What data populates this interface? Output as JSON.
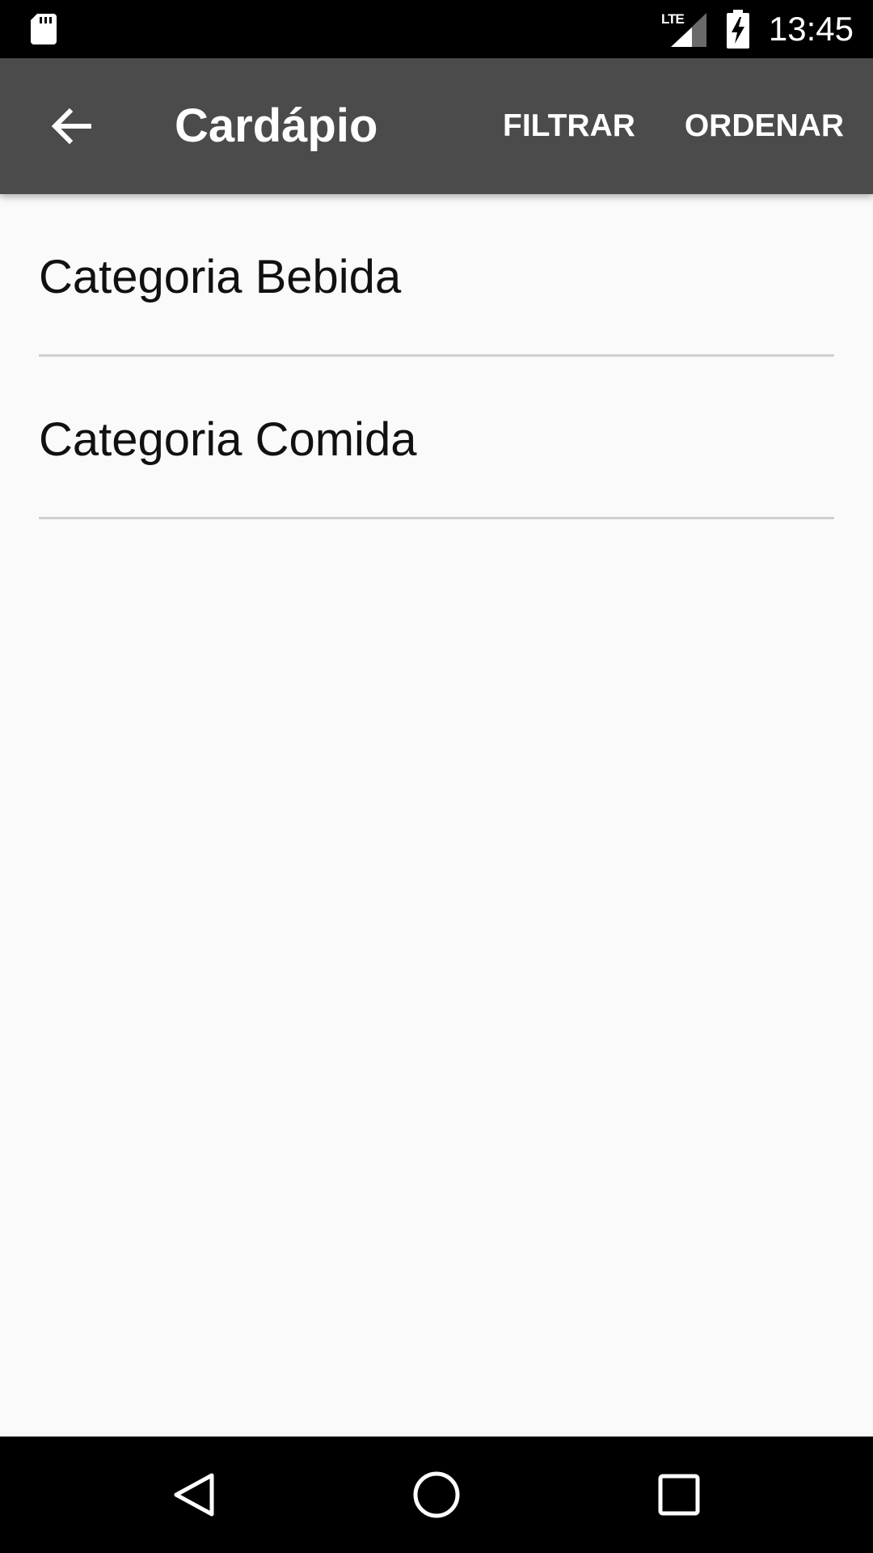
{
  "status_bar": {
    "time": "13:45",
    "network": "LTE",
    "icons": [
      "sd-card-icon",
      "lte-signal-icon",
      "battery-charging-icon"
    ]
  },
  "app_bar": {
    "title": "Cardápio",
    "back_icon": "arrow-back-icon",
    "actions": [
      {
        "label": "FILTRAR"
      },
      {
        "label": "ORDENAR"
      }
    ],
    "background_color": "#4b4b4b"
  },
  "categories": [
    {
      "label": "Categoria Bebida"
    },
    {
      "label": "Categoria Comida"
    }
  ],
  "nav_bar": {
    "icons": [
      "nav-back-icon",
      "nav-home-icon",
      "nav-recents-icon"
    ]
  }
}
